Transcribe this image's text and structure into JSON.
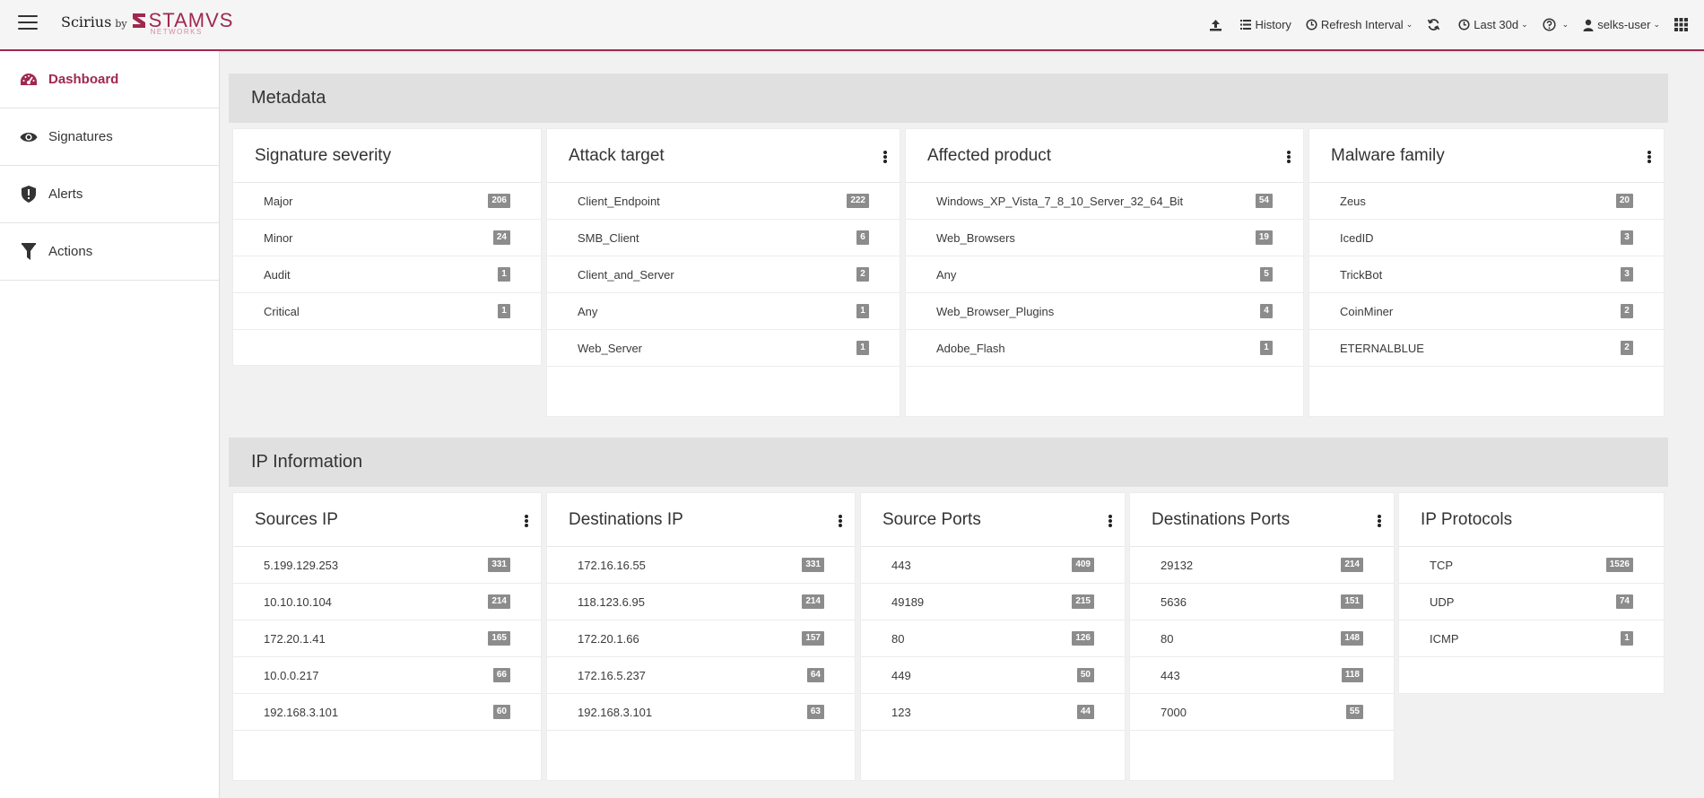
{
  "brand": {
    "name": "Scirius",
    "by": "by",
    "company": "STAMVS",
    "company_sub": "NETWORKS",
    "accent": "#a0284e"
  },
  "topnav": {
    "history": "History",
    "refresh_interval": "Refresh Interval",
    "time_range": "Last 30d",
    "user": "selks-user"
  },
  "sidebar": {
    "items": [
      {
        "label": "Dashboard",
        "icon": "dashboard-icon"
      },
      {
        "label": "Signatures",
        "icon": "eye-icon"
      },
      {
        "label": "Alerts",
        "icon": "shield-alert-icon"
      },
      {
        "label": "Actions",
        "icon": "filter-icon"
      }
    ]
  },
  "sections": {
    "metadata": "Metadata",
    "ip": "IP Information"
  },
  "cards": {
    "severity": {
      "title": "Signature severity",
      "rows": [
        {
          "label": "Major",
          "count": "206"
        },
        {
          "label": "Minor",
          "count": "24"
        },
        {
          "label": "Audit",
          "count": "1"
        },
        {
          "label": "Critical",
          "count": "1"
        }
      ]
    },
    "attack_target": {
      "title": "Attack target",
      "rows": [
        {
          "label": "Client_Endpoint",
          "count": "222"
        },
        {
          "label": "SMB_Client",
          "count": "6"
        },
        {
          "label": "Client_and_Server",
          "count": "2"
        },
        {
          "label": "Any",
          "count": "1"
        },
        {
          "label": "Web_Server",
          "count": "1"
        }
      ]
    },
    "affected_product": {
      "title": "Affected product",
      "rows": [
        {
          "label": "Windows_XP_Vista_7_8_10_Server_32_64_Bit",
          "count": "54"
        },
        {
          "label": "Web_Browsers",
          "count": "19"
        },
        {
          "label": "Any",
          "count": "5"
        },
        {
          "label": "Web_Browser_Plugins",
          "count": "4"
        },
        {
          "label": "Adobe_Flash",
          "count": "1"
        }
      ]
    },
    "malware_family": {
      "title": "Malware family",
      "rows": [
        {
          "label": "Zeus",
          "count": "20"
        },
        {
          "label": "IcedID",
          "count": "3"
        },
        {
          "label": "TrickBot",
          "count": "3"
        },
        {
          "label": "CoinMiner",
          "count": "2"
        },
        {
          "label": "ETERNALBLUE",
          "count": "2"
        }
      ]
    },
    "sources_ip": {
      "title": "Sources IP",
      "rows": [
        {
          "label": "5.199.129.253",
          "count": "331"
        },
        {
          "label": "10.10.10.104",
          "count": "214"
        },
        {
          "label": "172.20.1.41",
          "count": "165"
        },
        {
          "label": "10.0.0.217",
          "count": "66"
        },
        {
          "label": "192.168.3.101",
          "count": "60"
        }
      ]
    },
    "destinations_ip": {
      "title": "Destinations IP",
      "rows": [
        {
          "label": "172.16.16.55",
          "count": "331"
        },
        {
          "label": "118.123.6.95",
          "count": "214"
        },
        {
          "label": "172.20.1.66",
          "count": "157"
        },
        {
          "label": "172.16.5.237",
          "count": "64"
        },
        {
          "label": "192.168.3.101",
          "count": "63"
        }
      ]
    },
    "source_ports": {
      "title": "Source Ports",
      "rows": [
        {
          "label": "443",
          "count": "409"
        },
        {
          "label": "49189",
          "count": "215"
        },
        {
          "label": "80",
          "count": "126"
        },
        {
          "label": "449",
          "count": "50"
        },
        {
          "label": "123",
          "count": "44"
        }
      ]
    },
    "destinations_ports": {
      "title": "Destinations Ports",
      "rows": [
        {
          "label": "29132",
          "count": "214"
        },
        {
          "label": "5636",
          "count": "151"
        },
        {
          "label": "80",
          "count": "148"
        },
        {
          "label": "443",
          "count": "118"
        },
        {
          "label": "7000",
          "count": "55"
        }
      ]
    },
    "ip_protocols": {
      "title": "IP Protocols",
      "rows": [
        {
          "label": "TCP",
          "count": "1526"
        },
        {
          "label": "UDP",
          "count": "74"
        },
        {
          "label": "ICMP",
          "count": "1"
        }
      ]
    }
  }
}
